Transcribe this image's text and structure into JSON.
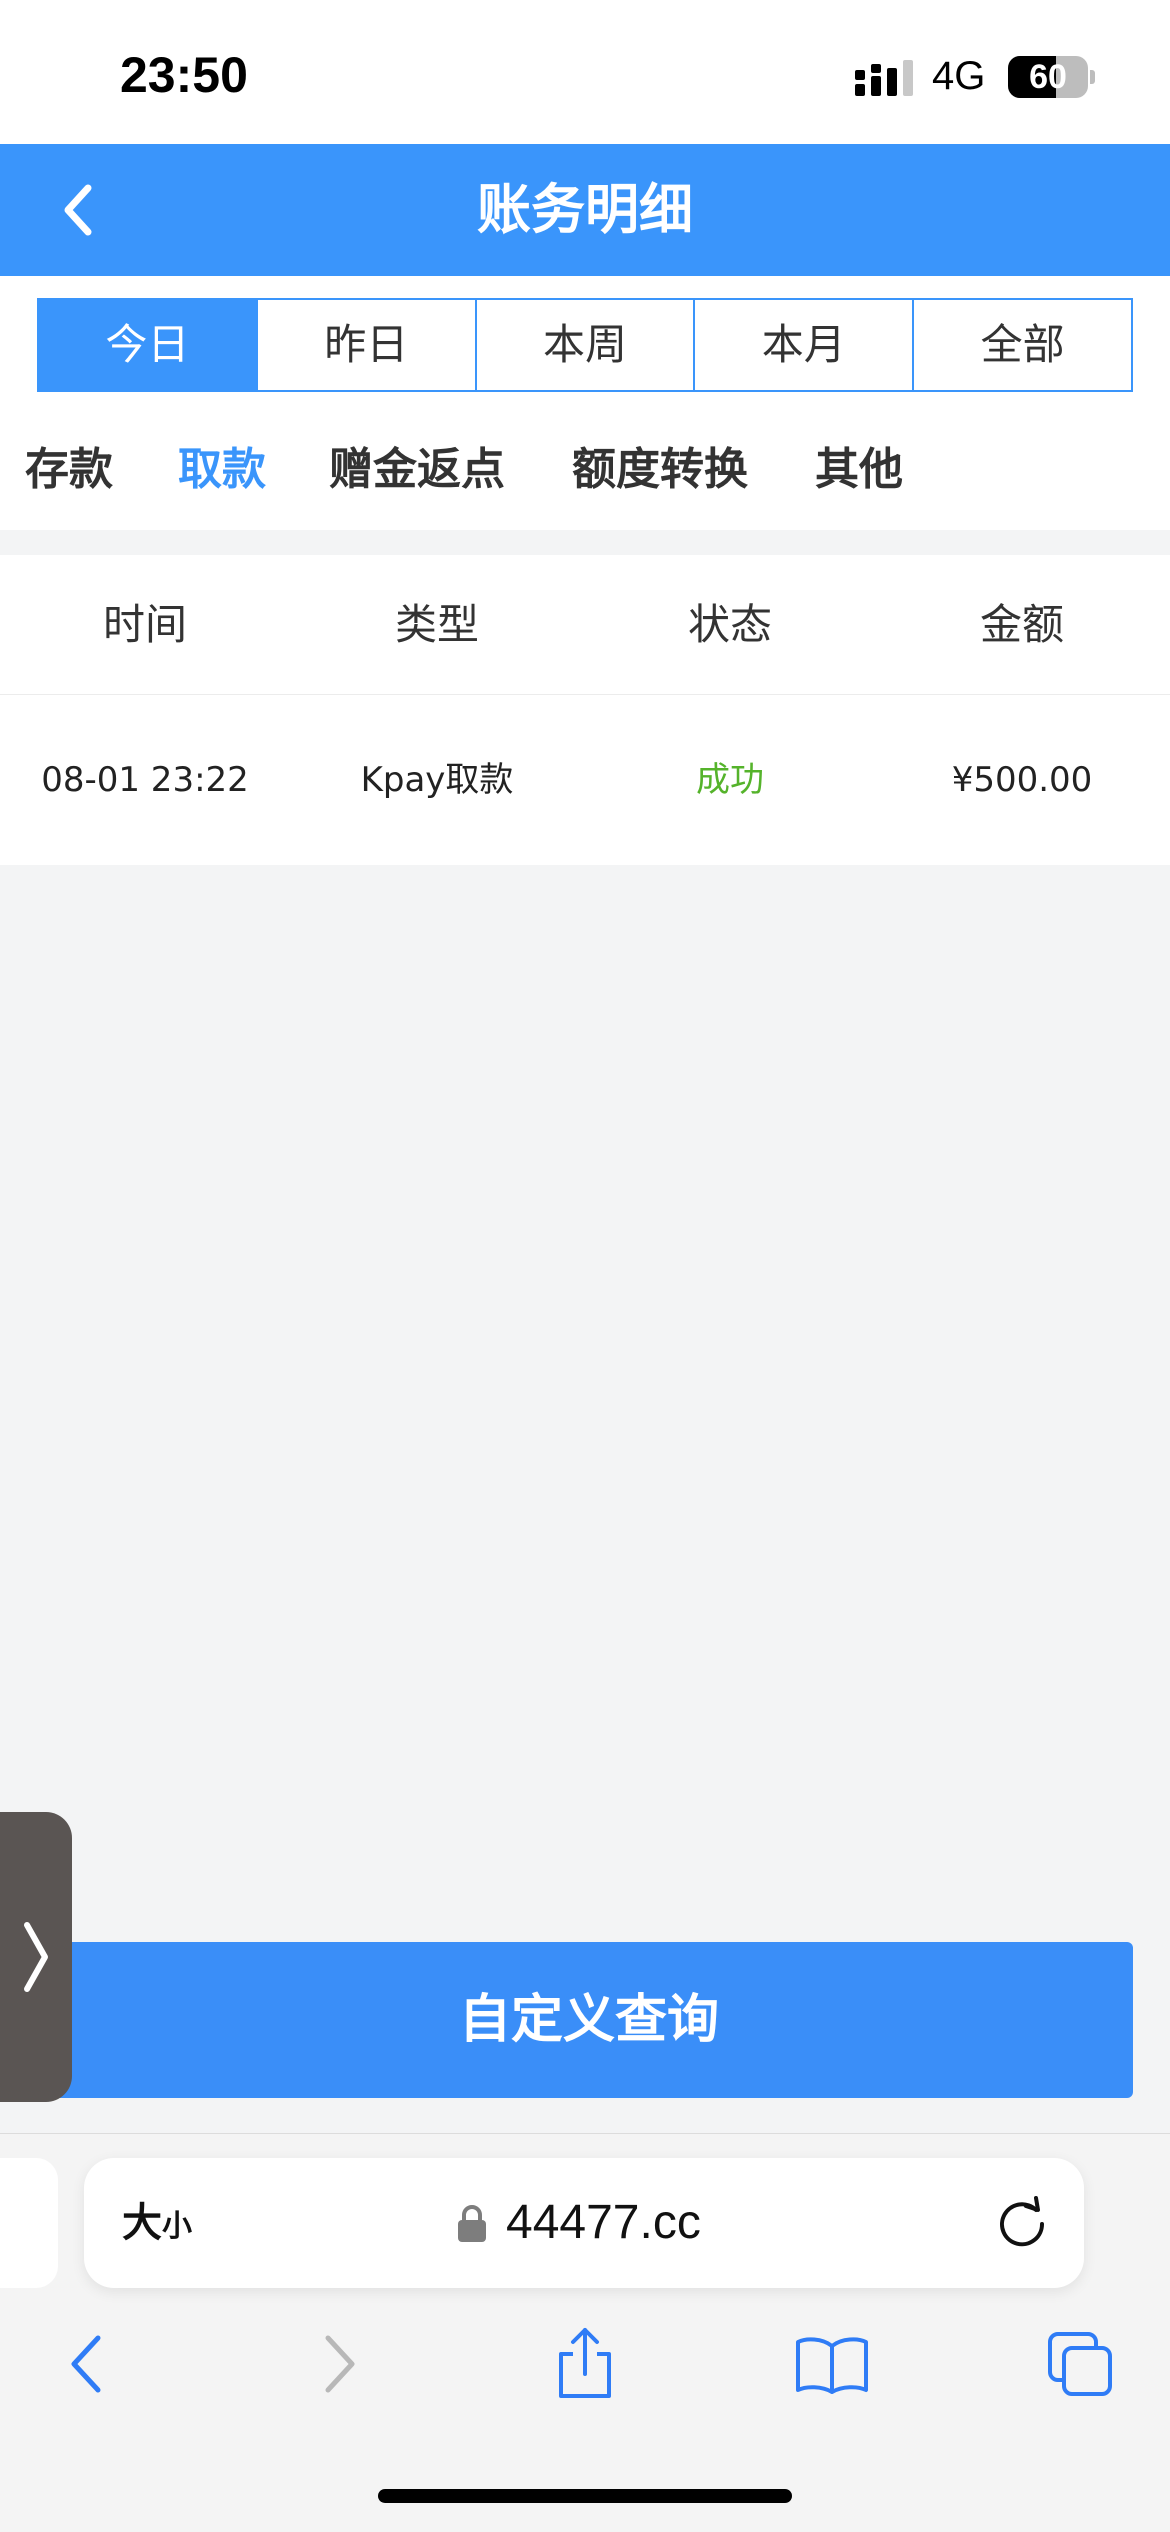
{
  "status_bar": {
    "time": "23:50",
    "network": "4G",
    "battery_level": "60",
    "battery_fraction": 0.6
  },
  "header": {
    "title": "账务明细",
    "back_icon": "chevron-left-icon"
  },
  "date_tabs": [
    {
      "label": "今日",
      "active": true
    },
    {
      "label": "昨日",
      "active": false
    },
    {
      "label": "本周",
      "active": false
    },
    {
      "label": "本月",
      "active": false
    },
    {
      "label": "全部",
      "active": false
    }
  ],
  "type_tabs": [
    {
      "label": "存款",
      "active": false
    },
    {
      "label": "取款",
      "active": true
    },
    {
      "label": "赠金返点",
      "active": false
    },
    {
      "label": "额度转换",
      "active": false
    },
    {
      "label": "其他",
      "active": false
    }
  ],
  "table": {
    "columns": [
      "时间",
      "类型",
      "状态",
      "金额"
    ],
    "rows": [
      {
        "time": "08-01 23:22",
        "type": "Kpay取款",
        "status": "成功",
        "amount": "¥500.00"
      }
    ]
  },
  "custom_query_label": "自定义查询",
  "browser": {
    "text_size_label": "大",
    "text_size_small": "小",
    "url": "44477.cc"
  },
  "colors": {
    "accent": "#3a95fb",
    "success": "#55b32b",
    "background": "#f3f4f5"
  }
}
